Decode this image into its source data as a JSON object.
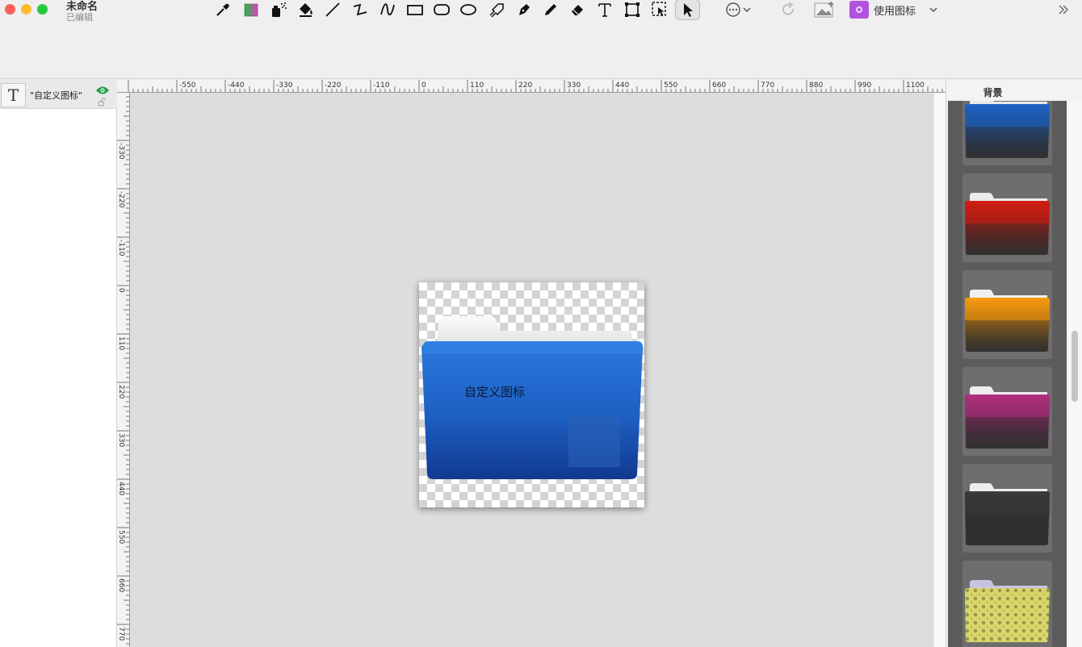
{
  "window": {
    "title": "未命名",
    "status": "已编辑"
  },
  "toolbar": {
    "tools": [
      {
        "name": "eyedropper-tool",
        "icon": "eyedropper-icon"
      },
      {
        "name": "color-tool",
        "icon": "color-swatch-icon"
      },
      {
        "name": "spray-tool",
        "icon": "spray-icon"
      },
      {
        "name": "fill-tool",
        "icon": "paint-bucket-icon"
      },
      {
        "name": "line-tool",
        "icon": "line-icon"
      },
      {
        "name": "polyline-tool",
        "icon": "zigzag-icon"
      },
      {
        "name": "curve-tool",
        "icon": "curve-icon"
      },
      {
        "name": "rectangle-tool",
        "icon": "rectangle-icon"
      },
      {
        "name": "rounded-rect-tool",
        "icon": "rounded-rectangle-icon"
      },
      {
        "name": "ellipse-tool",
        "icon": "ellipse-icon"
      },
      {
        "name": "lasso-tool",
        "icon": "lasso-icon"
      },
      {
        "name": "pen-tool",
        "icon": "pen-nib-icon"
      },
      {
        "name": "pencil-tool",
        "icon": "pencil-icon"
      },
      {
        "name": "eraser-tool",
        "icon": "eraser-icon"
      },
      {
        "name": "text-tool",
        "icon": "text-icon"
      },
      {
        "name": "transform-tool",
        "icon": "transform-icon"
      },
      {
        "name": "crop-select-tool",
        "icon": "selection-icon"
      },
      {
        "name": "select-tool",
        "icon": "arrow-cursor-icon"
      }
    ],
    "more_icon": "ellipsis-circle-icon",
    "use_icon_label": "使用图标"
  },
  "layers": {
    "items": [
      {
        "thumb": "T",
        "label": "\"自定义图标\""
      }
    ]
  },
  "rulers": {
    "horizontal": [
      "-550",
      "-440",
      "-330",
      "-220",
      "-110",
      "0",
      "110",
      "220",
      "330",
      "440",
      "550",
      "660",
      "770",
      "880",
      "990",
      "1100"
    ],
    "vertical": [
      "-330",
      "-220",
      "-110",
      "0",
      "110",
      "220",
      "330",
      "440",
      "550",
      "660",
      "770"
    ]
  },
  "canvas": {
    "label_text": "自定义图标",
    "folder_color": "#1f62c8"
  },
  "background_panel": {
    "title": "背景",
    "swatches": [
      {
        "name": "blue",
        "front": "#1e63c4",
        "back": "#e8e8e8"
      },
      {
        "name": "red",
        "front": "#d21d12",
        "back": "#ececec"
      },
      {
        "name": "orange",
        "front": "#f89a0c",
        "back": "#f0f0f0"
      },
      {
        "name": "magenta",
        "front": "#b0307e",
        "back": "#eeeeee"
      },
      {
        "name": "black",
        "front": "#3a3a3a",
        "back": "#ededed"
      },
      {
        "name": "damask-yellow",
        "front": "#d8d56a",
        "back": "#c9c3e2"
      }
    ]
  }
}
